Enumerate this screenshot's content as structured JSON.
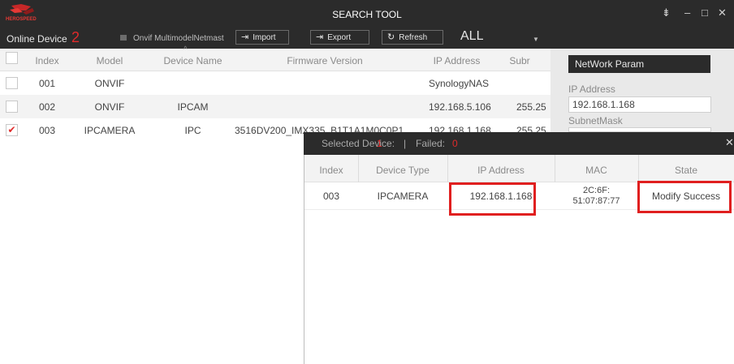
{
  "window": {
    "title": "SEARCH TOOL",
    "logo_text": "HEROSPEED",
    "controls": [
      "⇟",
      "–",
      "□",
      "✕"
    ]
  },
  "toolbar": {
    "online_label": "Online Device",
    "online_count": "2",
    "multicast_label": "Onvif MultimodelNetmast",
    "import_label": "Import",
    "export_label": "Export",
    "refresh_label": "Refresh",
    "filter_value": "ALL"
  },
  "device_table": {
    "headers": {
      "index": "Index",
      "model": "Model",
      "device_name": "Device Name",
      "firmware": "Firmware Version",
      "ip": "IP Address",
      "subnet": "Subr"
    },
    "rows": [
      {
        "index": "001",
        "model": "ONVIF",
        "device_name": "",
        "firmware": "",
        "ip": "SynologyNAS",
        "subnet": "",
        "checked": false
      },
      {
        "index": "002",
        "model": "ONVIF",
        "device_name": "IPCAM",
        "firmware": "",
        "ip": "192.168.5.106",
        "subnet": "255.25",
        "checked": false
      },
      {
        "index": "003",
        "model": "IPCAMERA",
        "device_name": "IPC",
        "firmware": "3516DV200_IMX335_B1T1A1M0C0P1",
        "ip": "192.168.1.168",
        "subnet": "255.25",
        "checked": true
      }
    ]
  },
  "network_panel": {
    "title": "NetWork Param",
    "ip_label": "IP Address",
    "ip_value": "192.168.1.168",
    "subnet_label": "SubnetMask"
  },
  "result_dialog": {
    "selected_label": "Selected Device:",
    "selected_count": "1",
    "separator": "|",
    "failed_label": "Failed:",
    "failed_count": "0",
    "headers": {
      "index": "Index",
      "device_type": "Device Type",
      "ip": "IP Address",
      "mac": "MAC",
      "state": "State"
    },
    "row": {
      "index": "003",
      "device_type": "IPCAMERA",
      "ip": "192.168.1.168",
      "mac_line1": "2C:6F:",
      "mac_line2": "51:07:87:77",
      "state": "Modify Success"
    }
  },
  "colors": {
    "dark_bar": "#2b2b2b",
    "accent_red": "#e02a2a",
    "highlight_red": "#e01f1f",
    "panel_gray": "#e9e9e9"
  }
}
